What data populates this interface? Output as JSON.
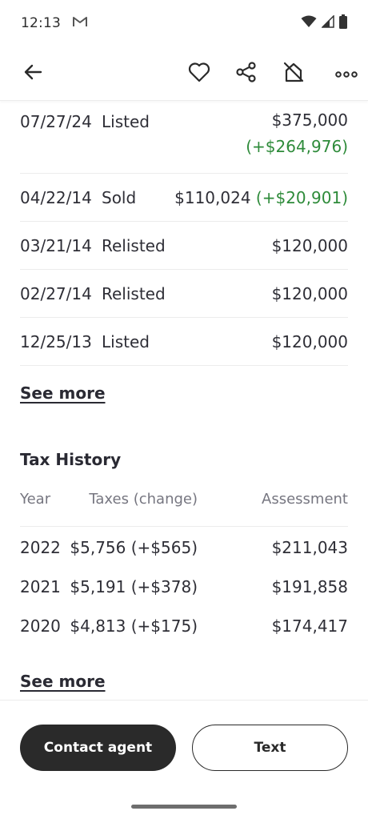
{
  "status_bar": {
    "time": "12:13",
    "icons": [
      "gmail-icon",
      "wifi-icon",
      "signal-icon",
      "battery-icon"
    ]
  },
  "toolbar": {
    "icons": [
      "back-arrow-icon",
      "heart-icon",
      "share-icon",
      "hide-icon",
      "more-icon"
    ]
  },
  "sale_history": [
    {
      "date": "07/27/24",
      "event": "Listed",
      "price": "$375,000",
      "change": "(+$264,976)"
    },
    {
      "date": "04/22/14",
      "event": "Sold",
      "price": "$110,024",
      "change": "(+$20,901)"
    },
    {
      "date": "03/21/14",
      "event": "Relisted",
      "price": "$120,000",
      "change": ""
    },
    {
      "date": "02/27/14",
      "event": "Relisted",
      "price": "$120,000",
      "change": ""
    },
    {
      "date": "12/25/13",
      "event": "Listed",
      "price": "$120,000",
      "change": ""
    }
  ],
  "see_more_label": "See more",
  "tax_history": {
    "title": "Tax History",
    "headers": {
      "year": "Year",
      "taxes": "Taxes (change)",
      "assessment": "Assessment"
    },
    "rows": [
      {
        "year": "2022",
        "taxes": "$5,756 (+$565)",
        "assessment": "$211,043"
      },
      {
        "year": "2021",
        "taxes": "$5,191 (+$378)",
        "assessment": "$191,858"
      },
      {
        "year": "2020",
        "taxes": "$4,813 (+$175)",
        "assessment": "$174,417"
      }
    ],
    "see_more_label": "See more"
  },
  "actions": {
    "contact_label": "Contact agent",
    "text_label": "Text"
  },
  "colors": {
    "positive_change": "#2e8b3a",
    "primary_button": "#2a2a2a"
  }
}
